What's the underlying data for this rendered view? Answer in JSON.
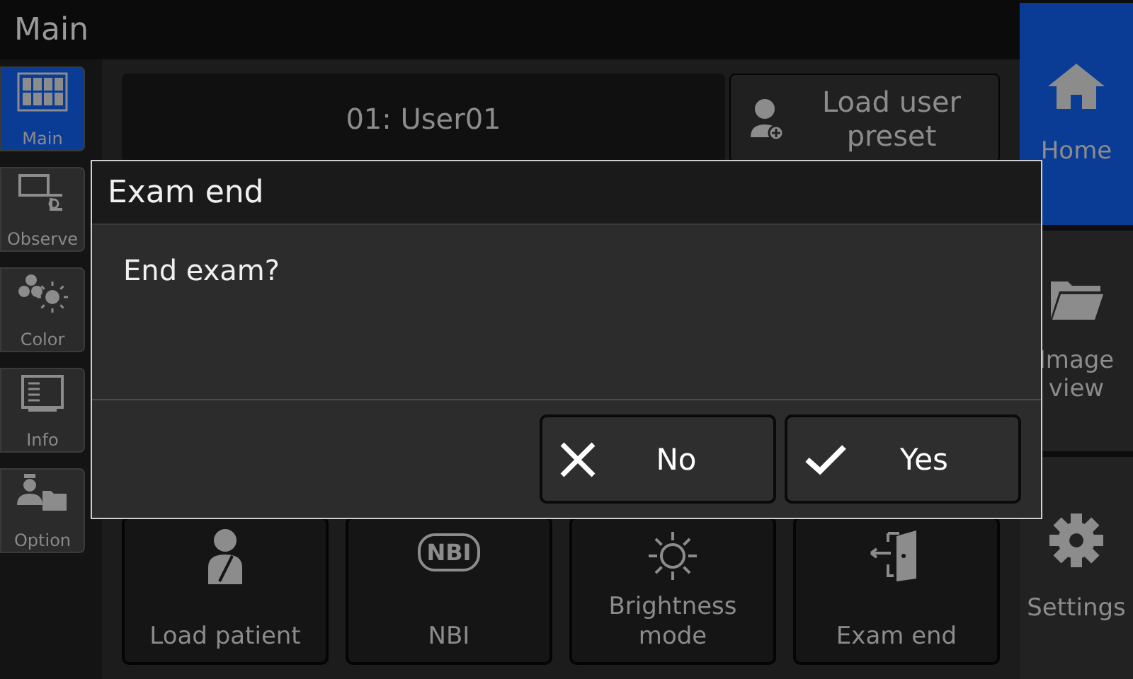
{
  "header": {
    "title": "Main"
  },
  "sidebar": {
    "items": [
      {
        "label": "Main",
        "kind": "grid",
        "selected": true
      },
      {
        "label": "Observe",
        "kind": "monitor",
        "selected": false
      },
      {
        "label": "Color",
        "kind": "color",
        "selected": false
      },
      {
        "label": "Info",
        "kind": "info",
        "selected": false
      },
      {
        "label": "Option",
        "kind": "option",
        "selected": false
      }
    ]
  },
  "user": {
    "value": "01: User01",
    "preset_button": "Load user preset"
  },
  "actions": [
    {
      "label": "Load patient",
      "kind": "patient"
    },
    {
      "label": "NBI",
      "kind": "nbi",
      "icon_text": "NBI"
    },
    {
      "label": "Brightness mode",
      "kind": "sun"
    },
    {
      "label": "Exam end",
      "kind": "door"
    }
  ],
  "nav": [
    {
      "label": "Home",
      "kind": "home",
      "selected": true
    },
    {
      "label": "Image view",
      "kind": "folder",
      "selected": false
    },
    {
      "label": "Settings",
      "kind": "gear",
      "selected": false
    }
  ],
  "dialog": {
    "title": "Exam end",
    "message": "End exam?",
    "buttons": [
      {
        "label": "No",
        "kind": "cancel"
      },
      {
        "label": "Yes",
        "kind": "confirm"
      }
    ]
  }
}
